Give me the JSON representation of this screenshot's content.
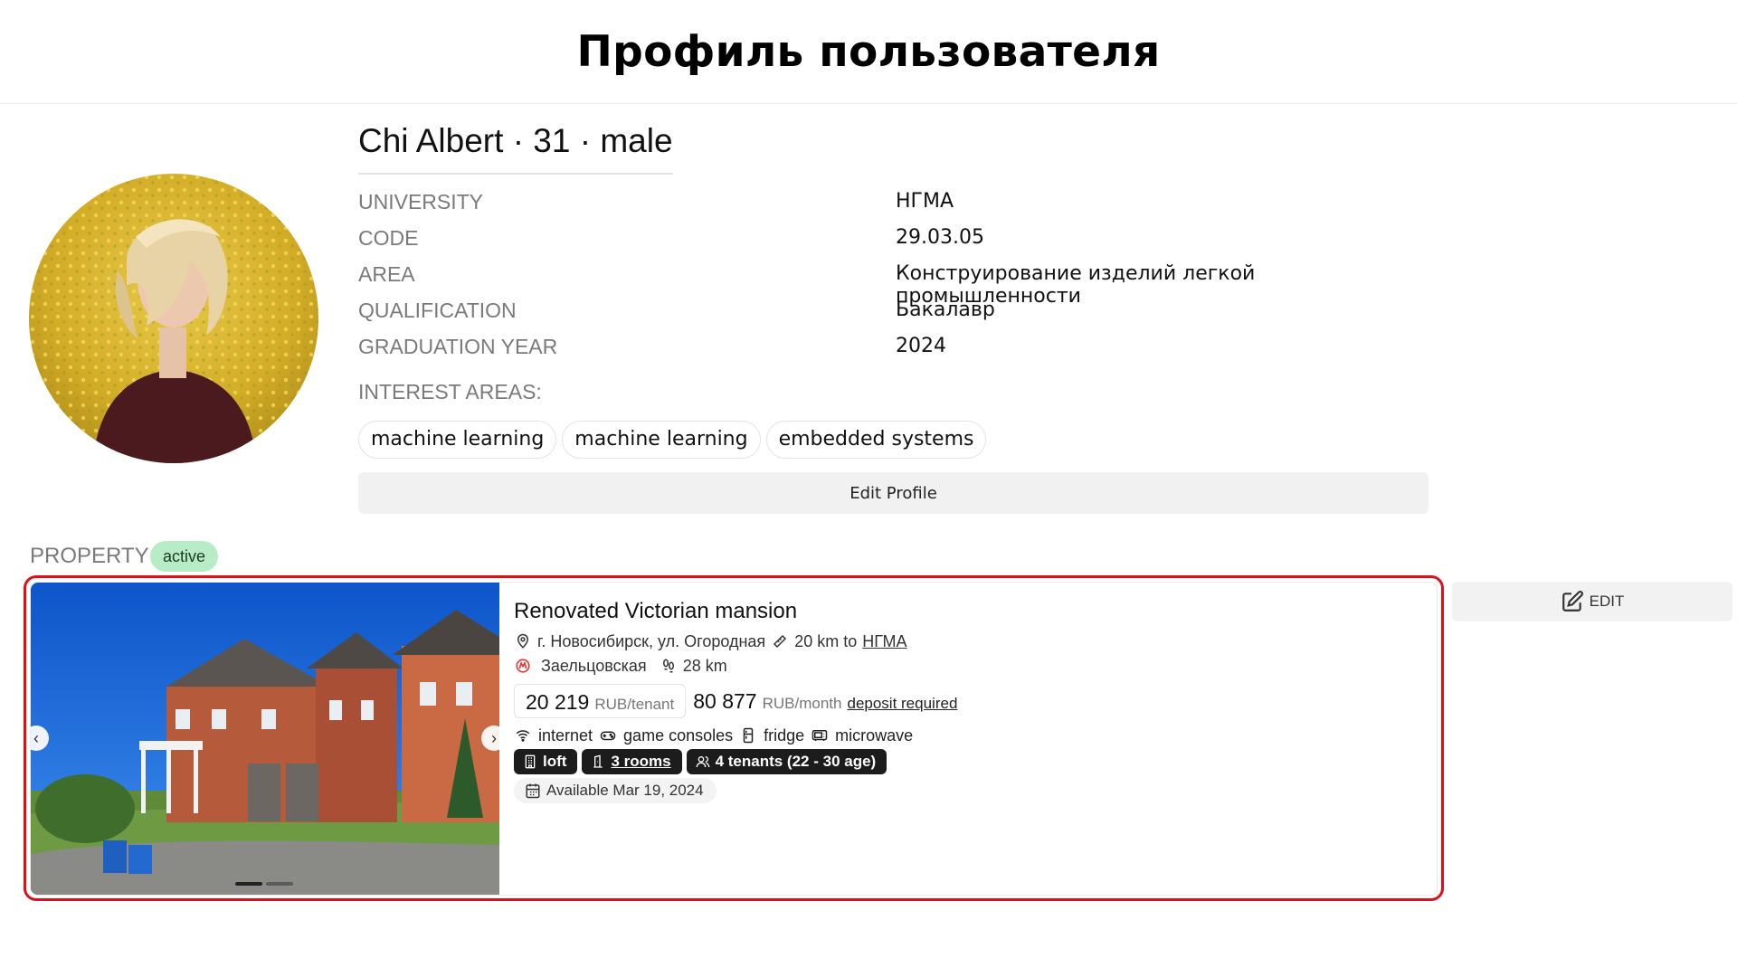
{
  "page": {
    "title": "Профиль пользователя"
  },
  "profile": {
    "name_line": "Chi Albert · 31 · male",
    "fields": [
      {
        "label": "UNIVERSITY",
        "value": "НГМА"
      },
      {
        "label": "CODE",
        "value": "29.03.05"
      },
      {
        "label": "AREA",
        "value": "Конструирование изделий легкой промышленности"
      },
      {
        "label": "QUALIFICATION",
        "value": "Бакалавр"
      },
      {
        "label": "GRADUATION YEAR",
        "value": "2024"
      }
    ],
    "interests_label": "INTEREST AREAS:",
    "interests": [
      "machine learning",
      "machine learning",
      "embedded systems"
    ],
    "edit_label": "Edit Profile"
  },
  "property": {
    "section_label": "PROPERTY",
    "status": "active",
    "edit_label": "EDIT",
    "listing": {
      "title": "Renovated Victorian mansion",
      "address": "г. Новосибирск, ул. Огородная",
      "distance_prefix": "20 km to",
      "distance_target": "НГМА",
      "metro_station": "Заельцовская",
      "walk_distance": "28 km",
      "price_per_tenant": "20 219",
      "price_per_tenant_unit": "RUB/tenant",
      "price_per_month": "80 877",
      "price_per_month_unit": "RUB/month",
      "deposit_label": "deposit required",
      "amenities": [
        "internet",
        "game consoles",
        "fridge",
        "microwave"
      ],
      "type": "loft",
      "rooms": "3 rooms",
      "tenants": "4 tenants (22 - 30 age)",
      "available": "Available Mar 19, 2024"
    },
    "photo_slides": {
      "count": 2,
      "active_index": 0
    }
  },
  "colors": {
    "highlight": "#e0101b",
    "status_bg": "#b8ecc7",
    "pill_bg": "#1c1c1c",
    "metro_icon": "#e53935"
  },
  "icons": [
    "map-pin-icon",
    "ruler-icon",
    "metro-icon",
    "footsteps-icon",
    "wifi-icon",
    "gamepad-icon",
    "fridge-icon",
    "microwave-icon",
    "building-icon",
    "door-icon",
    "users-icon",
    "calendar-icon",
    "edit-icon",
    "chevron-left-icon",
    "chevron-right-icon"
  ]
}
